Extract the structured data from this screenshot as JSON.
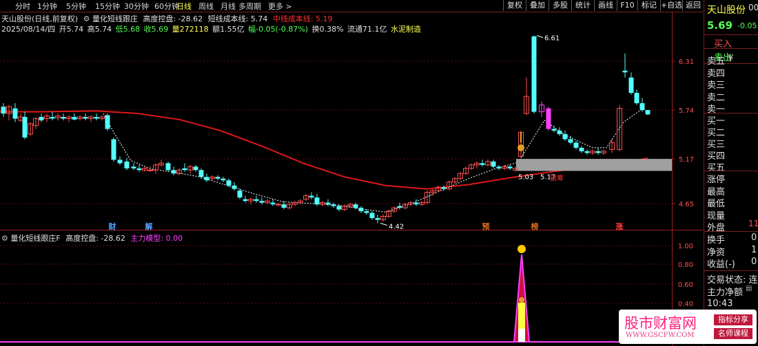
{
  "period_tabs": [
    "分时",
    "1分钟",
    "5分钟",
    "15分钟",
    "30分钟",
    "60分钟",
    "日线",
    "周线",
    "月线",
    "多周期",
    "更多 >"
  ],
  "active_period": "日线",
  "toolbar": [
    "复权",
    "叠加",
    "多股",
    "统计",
    "画线",
    "F10",
    "标记",
    "+自选",
    "返回"
  ],
  "main_header": {
    "stock": "天山股份(日线,前复权)",
    "indicator": "量化短线跟庄",
    "control_label": "高度控盘: -28.62",
    "short_cost": "短线成本线: 5.74",
    "mid_cost": "中线成本线: 5.19"
  },
  "quote_line": {
    "date": "2025/08/14/四",
    "open": "开5.74",
    "high": "高5.74",
    "low": "低5.68",
    "close": "收5.69",
    "volume": "量272118",
    "amount": "额1.55亿",
    "change": "幅-0.05(-0.87%)",
    "turnover": "换0.38%",
    "float": "流通71.1亿",
    "sector": "水泥制造"
  },
  "price_axis": [
    "6.31",
    "5.74",
    "5.17",
    "4.65"
  ],
  "annotations": {
    "peak": "6.61",
    "low": "4.42",
    "band_left": "5.03",
    "band_right": "5.17",
    "band_label": "锁筹"
  },
  "event_markers": [
    "财",
    "解",
    "预",
    "榜",
    "涨"
  ],
  "sub_header": {
    "indicator": "量化短线跟庄F",
    "control_label": "高度控盘: -28.62",
    "main_model": "主力模型: 0.00"
  },
  "sub_axis": [
    "1.00",
    "0.80",
    "0.60",
    "0.40"
  ],
  "side_panel": {
    "name": "天山股份",
    "code_partial": "00",
    "price": "5.69",
    "change": "-0.05",
    "buy_btn": "买入",
    "sell_btn": "卖出",
    "asks": [
      "卖五",
      "卖四",
      "卖三",
      "卖二",
      "卖一"
    ],
    "ask_currency": "¥",
    "bids": [
      "买一",
      "买二",
      "买三",
      "买四",
      "买五"
    ],
    "stats": [
      "涨停",
      "最高",
      "最低",
      "现量",
      "外盘"
    ],
    "outer_value": "11",
    "stats2": [
      "换手",
      "净资",
      "收益(-)"
    ],
    "stats2_values": [
      "0",
      "1",
      "0"
    ],
    "status_label": "交易状态: 连",
    "net_label": "主力净额",
    "time": "10:43"
  },
  "watermark": {
    "title": "股市财富网",
    "url": "WWW.GSCFW.COM",
    "tag1": "指标分享",
    "tag2": "名师课程"
  },
  "colors": {
    "up": "#ff5050",
    "down": "#54ffff",
    "ma": "#e01818",
    "accent": "#ffff54",
    "magenta": "#ff40ff",
    "grid": "#5a1010"
  }
}
